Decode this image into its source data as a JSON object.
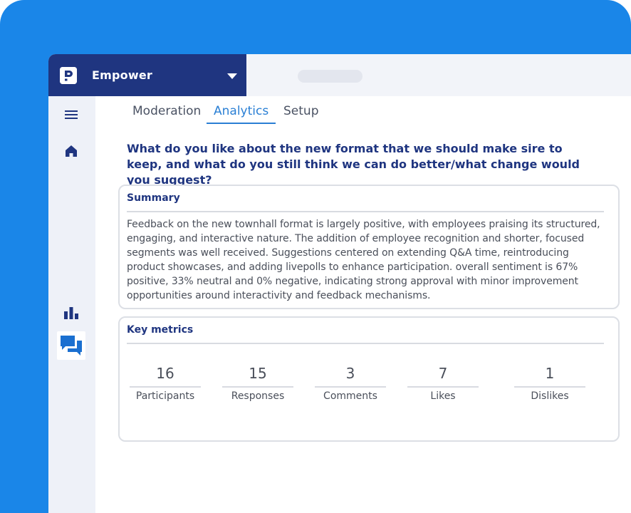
{
  "app": {
    "name": "Empower"
  },
  "tabs": [
    {
      "label": "Moderation",
      "active": false
    },
    {
      "label": "Analytics",
      "active": true
    },
    {
      "label": "Setup",
      "active": false
    }
  ],
  "question": "What do you like about the new format that we should make sire to keep, and what do you still think we can do better/what change would you suggest?",
  "summary": {
    "title": "Summary",
    "text": "Feedback on the new townhall format is largely positive, with employees praising its structured, engaging, and interactive nature. The addition of employee recognition and shorter, focused segments was well received. Suggestions centered on extending Q&A time, reintroducing product showcases, and adding livepolls to enhance participation. overall sentiment is 67% positive, 33% neutral and 0% negative, indicating strong approval with minor improvement opportunities around interactivity and feedback mechanisms."
  },
  "metrics": {
    "title": "Key metrics",
    "items": [
      {
        "value": "16",
        "label": "Participants"
      },
      {
        "value": "15",
        "label": "Responses"
      },
      {
        "value": "3",
        "label": "Comments"
      },
      {
        "value": "7",
        "label": "Likes"
      },
      {
        "value": "1",
        "label": "Dislikes"
      }
    ]
  },
  "icons": {
    "brand": "logo-icon",
    "dropdown": "caret-down-icon",
    "menu": "hamburger-menu-icon",
    "home": "home-icon",
    "analytics": "bar-chart-icon",
    "feedback": "chat-bubbles-icon"
  },
  "colors": {
    "backdrop": "#1a86e8",
    "brand_bar": "#1f3580",
    "accent": "#2a7fd4",
    "heading": "#1f3580",
    "sidebar": "#eef1f8"
  }
}
